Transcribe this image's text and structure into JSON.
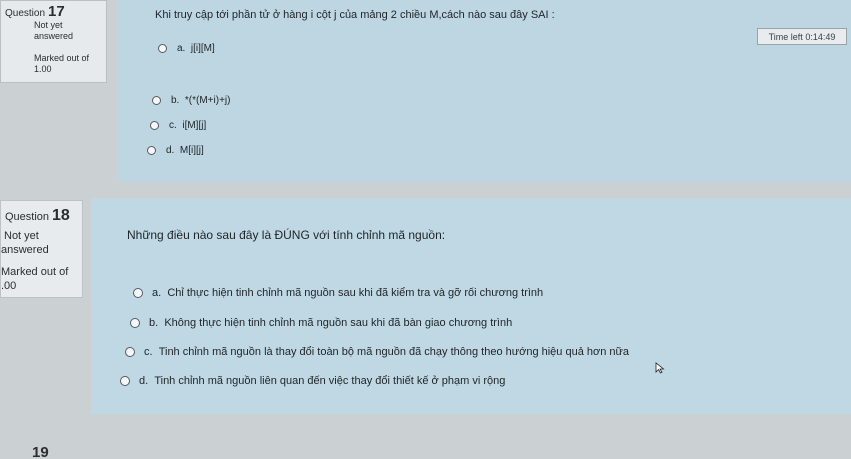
{
  "q17": {
    "question_label": "Question",
    "number": "17",
    "status": "Not yet answered",
    "marked": "Marked out of 1.00",
    "text": "Khi truy cập tới phần tử ở hàng i cột j của mảng 2 chiều M,cách nào sau đây SAI :",
    "options": [
      {
        "letter": "a.",
        "text": "j[i][M]"
      },
      {
        "letter": "b.",
        "text": "*(*(M+i)+j)"
      },
      {
        "letter": "c.",
        "text": "i[M][j]"
      },
      {
        "letter": "d.",
        "text": "M[i][j]"
      }
    ]
  },
  "timer": "Time left 0:14:49",
  "q18": {
    "question_label": "Question",
    "number": "18",
    "status_line1": "Not yet",
    "status_line2": "answered",
    "marked_line1": "Marked out of",
    "marked_line2": ".00",
    "text": "Những điều nào sau đây là ĐÚNG với tính chỉnh mã nguồn:",
    "options": [
      {
        "letter": "a.",
        "text": "Chỉ thực hiện tinh chỉnh mã nguồn sau khi đã kiểm tra và gỡ rối chương trình"
      },
      {
        "letter": "b.",
        "text": "Không thực hiện tinh chỉnh mã nguồn sau khi đã bàn giao chương trình"
      },
      {
        "letter": "c.",
        "text": "Tinh chỉnh mã nguồn là thay đổi toàn bộ mã nguồn đã chạy thông theo hướng hiệu quả hơn nữa"
      },
      {
        "letter": "d.",
        "text": "Tinh chỉnh mã nguồn liên quan đến việc thay đổi thiết kế ở phạm vi rộng"
      }
    ]
  },
  "q19": {
    "number": "19"
  }
}
